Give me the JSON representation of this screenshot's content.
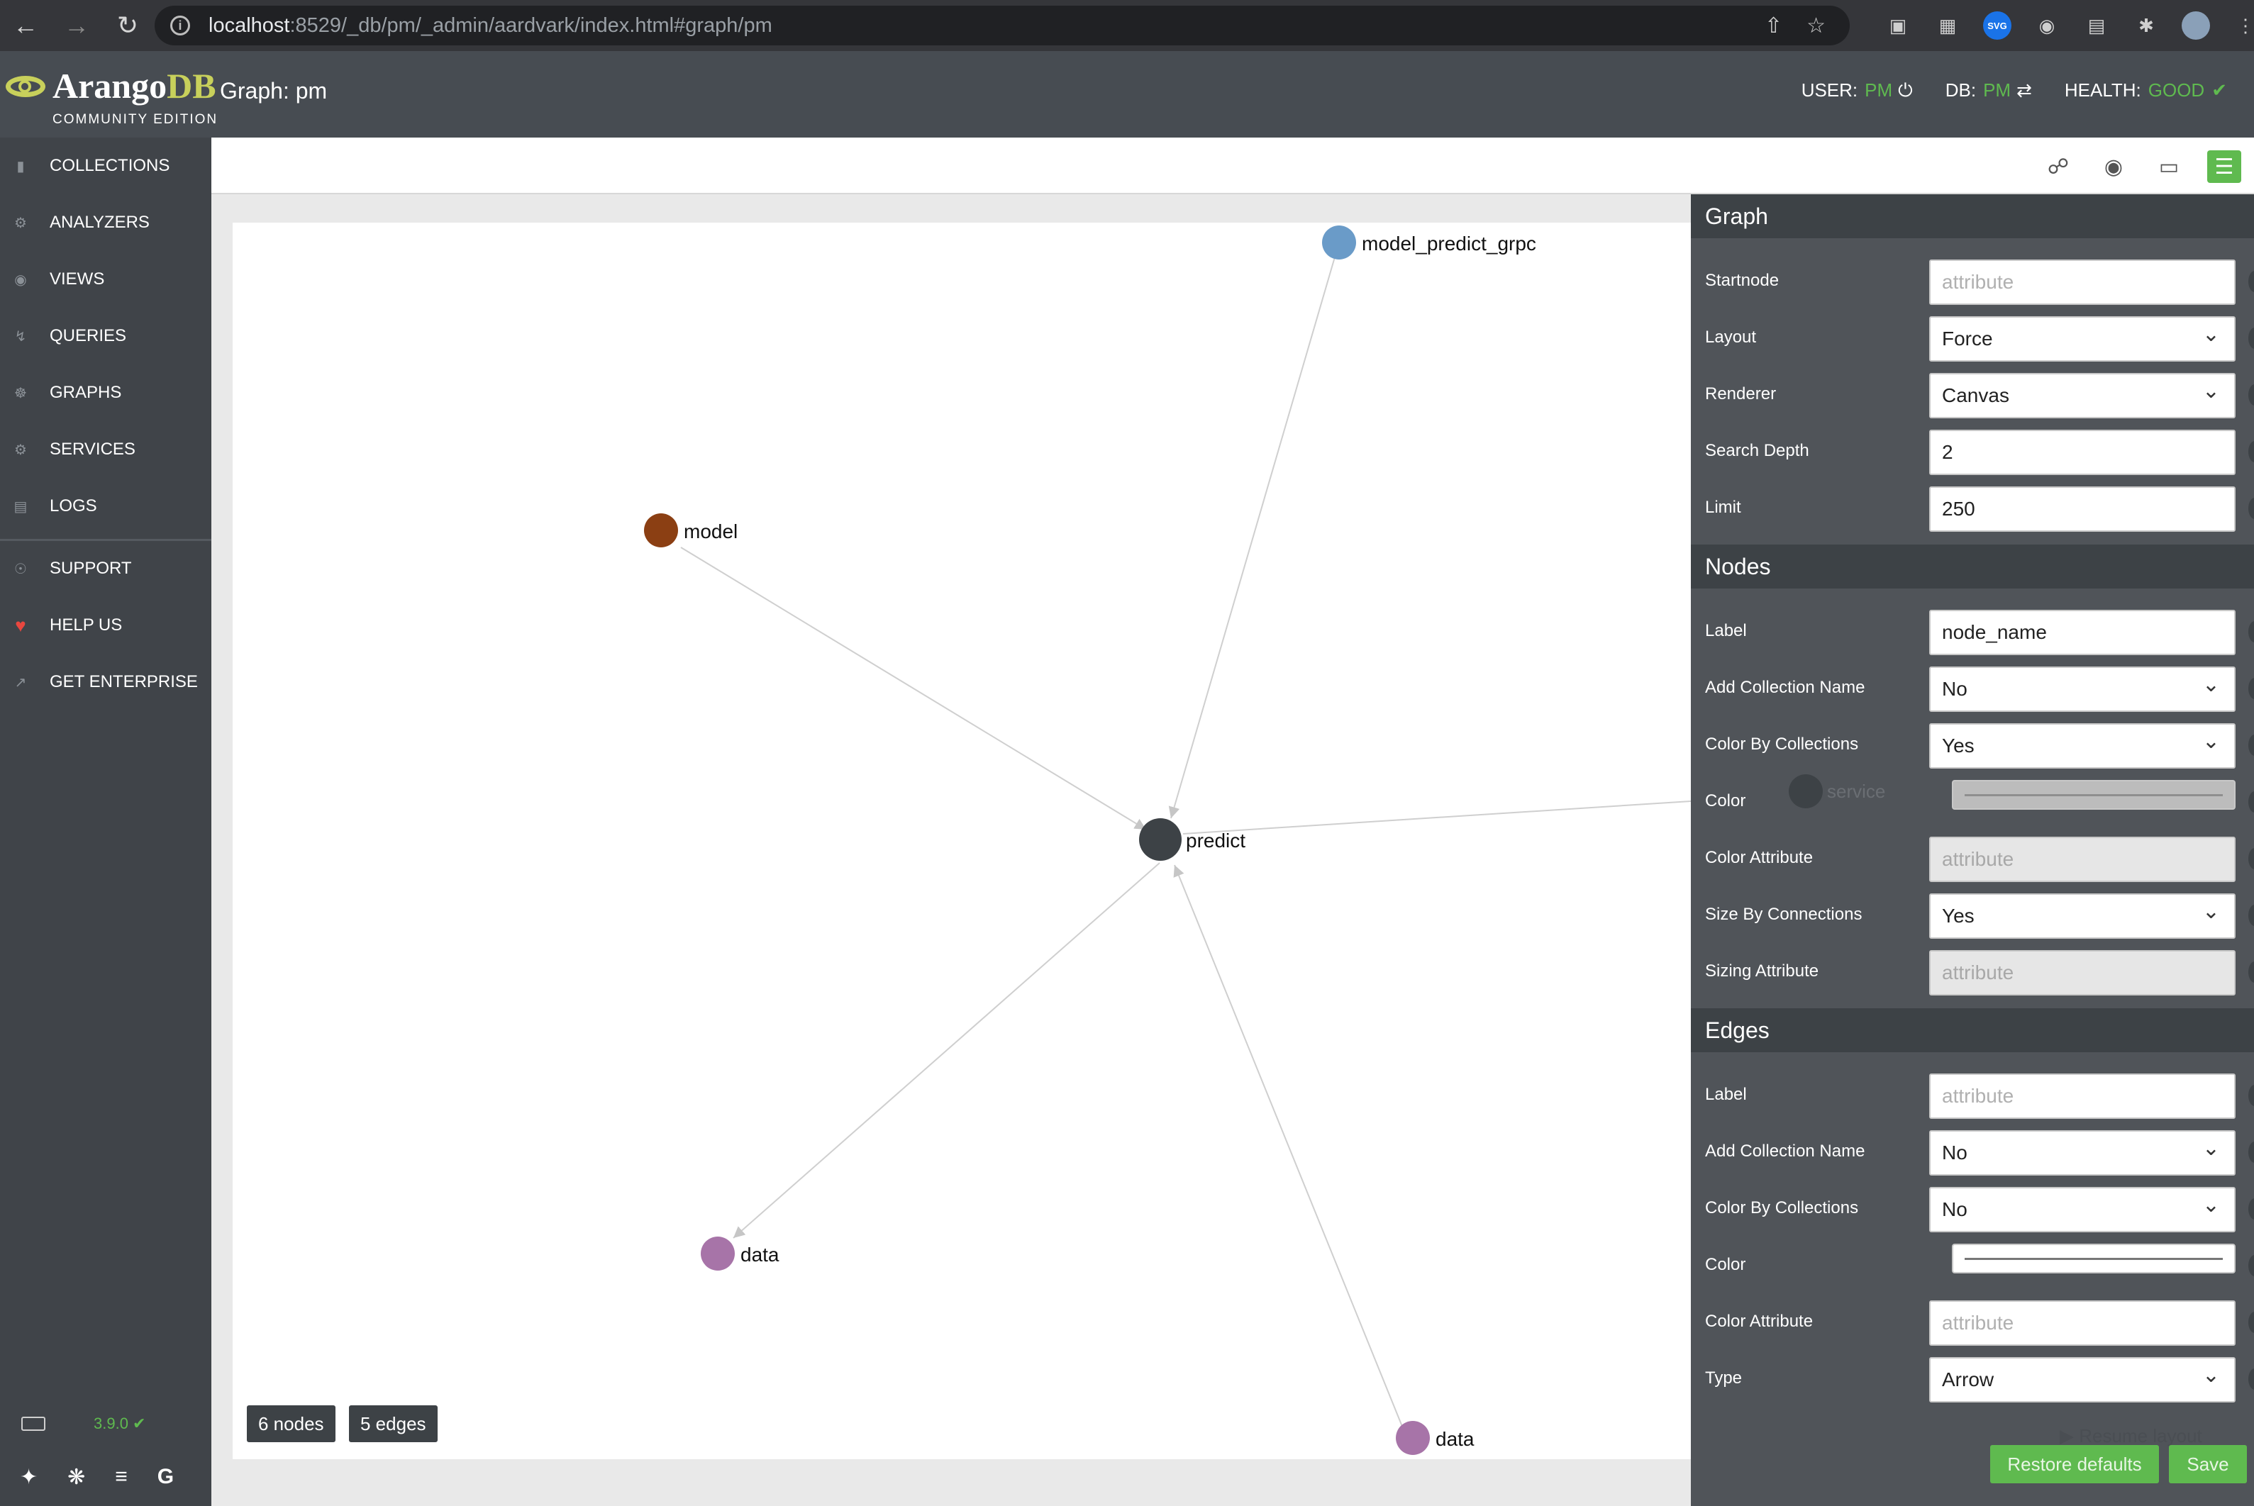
{
  "browser": {
    "url_host": "localhost",
    "url_rest": ":8529/_db/pm/_admin/aardvark/index.html#graph/pm",
    "svg_ext_label": "SVG"
  },
  "header": {
    "logo_main": "Arango",
    "logo_db": "DB",
    "logo_sub": "COMMUNITY EDITION",
    "title": "Graph: pm",
    "user_label": "USER:",
    "user_value": "PM",
    "db_label": "DB:",
    "db_value": "PM",
    "health_label": "HEALTH:",
    "health_value": "GOOD"
  },
  "sidebar": {
    "items": [
      {
        "label": "COLLECTIONS"
      },
      {
        "label": "ANALYZERS"
      },
      {
        "label": "VIEWS"
      },
      {
        "label": "QUERIES"
      },
      {
        "label": "GRAPHS"
      },
      {
        "label": "SERVICES"
      },
      {
        "label": "LOGS"
      },
      {
        "label": "SUPPORT"
      },
      {
        "label": "HELP US"
      },
      {
        "label": "GET ENTERPRISE"
      }
    ],
    "version": "3.9.0"
  },
  "graph": {
    "nodes": [
      {
        "label": "model_predict_grpc",
        "color": "#6a9bc8"
      },
      {
        "label": "model",
        "color": "#8b3f13"
      },
      {
        "label": "predict",
        "color": "#3d4246"
      },
      {
        "label": "data",
        "color": "#a774a8"
      },
      {
        "label": "data",
        "color": "#a774a8"
      }
    ],
    "node_count": "6 nodes",
    "edge_count": "5 edges"
  },
  "panel": {
    "graph_title": "Graph",
    "startnode_label": "Startnode",
    "startnode_placeholder": "attribute",
    "layout_label": "Layout",
    "layout_value": "Force",
    "renderer_label": "Renderer",
    "renderer_value": "Canvas",
    "depth_label": "Search Depth",
    "depth_value": "2",
    "limit_label": "Limit",
    "limit_value": "250",
    "nodes_title": "Nodes",
    "node_label_label": "Label",
    "node_label_value": "node_name",
    "node_addcoll_label": "Add Collection Name",
    "node_addcoll_value": "No",
    "node_colorby_label": "Color By Collections",
    "node_colorby_value": "Yes",
    "node_color_label": "Color",
    "ghost_node_label": "service",
    "node_colorattr_label": "Color Attribute",
    "node_colorattr_placeholder": "attribute",
    "node_sizeby_label": "Size By Connections",
    "node_sizeby_value": "Yes",
    "node_sizeattr_label": "Sizing Attribute",
    "node_sizeattr_placeholder": "attribute",
    "edges_title": "Edges",
    "edge_label_label": "Label",
    "edge_label_placeholder": "attribute",
    "edge_addcoll_label": "Add Collection Name",
    "edge_addcoll_value": "No",
    "edge_colorby_label": "Color By Collections",
    "edge_colorby_value": "No",
    "edge_color_label": "Color",
    "edge_colorattr_label": "Color Attribute",
    "edge_colorattr_placeholder": "attribute",
    "edge_type_label": "Type",
    "edge_type_value": "Arrow",
    "resume_label": "Resume layout",
    "restore_button": "Restore defaults",
    "save_button": "Save"
  }
}
